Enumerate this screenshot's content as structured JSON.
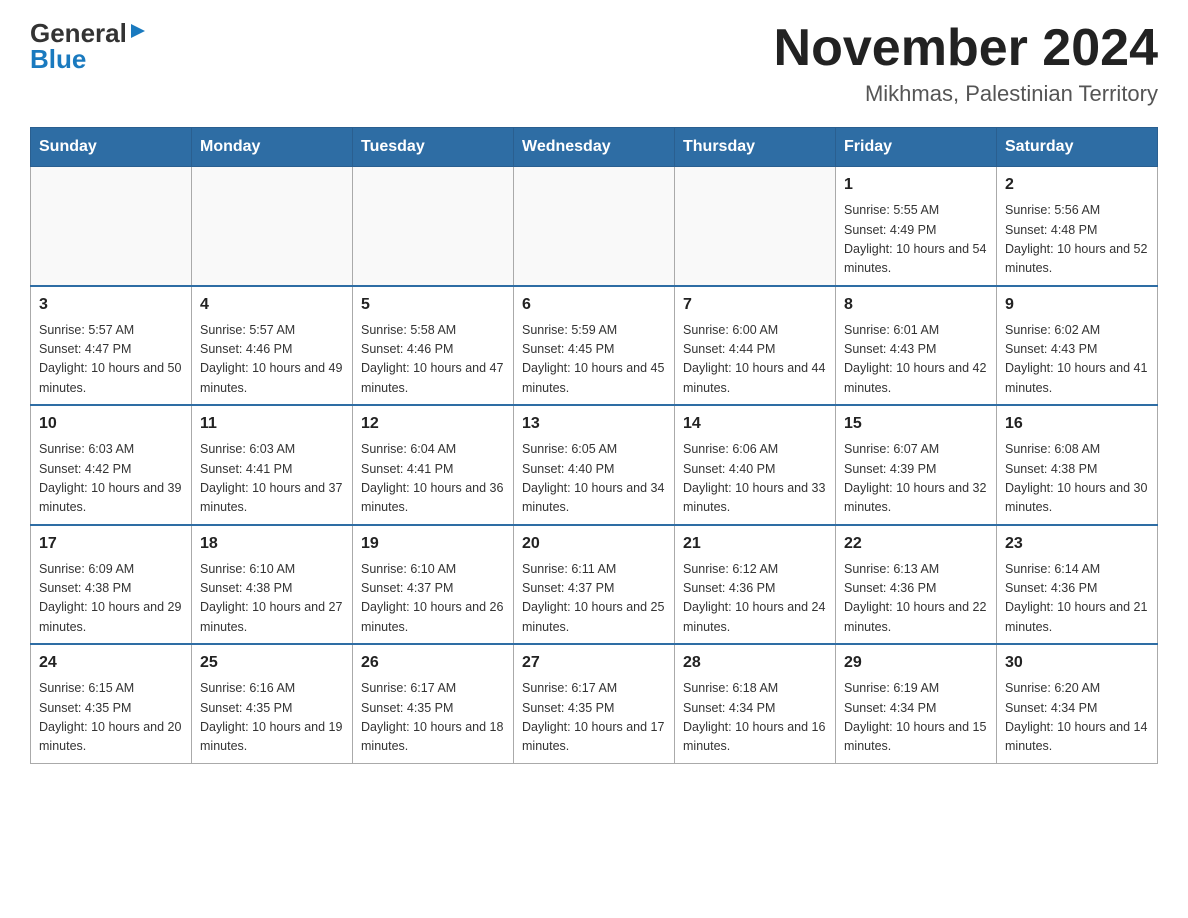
{
  "logo": {
    "general": "General",
    "blue": "Blue",
    "triangle": "▶"
  },
  "title": "November 2024",
  "subtitle": "Mikhmas, Palestinian Territory",
  "days_of_week": [
    "Sunday",
    "Monday",
    "Tuesday",
    "Wednesday",
    "Thursday",
    "Friday",
    "Saturday"
  ],
  "weeks": [
    [
      {
        "day": "",
        "info": ""
      },
      {
        "day": "",
        "info": ""
      },
      {
        "day": "",
        "info": ""
      },
      {
        "day": "",
        "info": ""
      },
      {
        "day": "",
        "info": ""
      },
      {
        "day": "1",
        "info": "Sunrise: 5:55 AM\nSunset: 4:49 PM\nDaylight: 10 hours and 54 minutes."
      },
      {
        "day": "2",
        "info": "Sunrise: 5:56 AM\nSunset: 4:48 PM\nDaylight: 10 hours and 52 minutes."
      }
    ],
    [
      {
        "day": "3",
        "info": "Sunrise: 5:57 AM\nSunset: 4:47 PM\nDaylight: 10 hours and 50 minutes."
      },
      {
        "day": "4",
        "info": "Sunrise: 5:57 AM\nSunset: 4:46 PM\nDaylight: 10 hours and 49 minutes."
      },
      {
        "day": "5",
        "info": "Sunrise: 5:58 AM\nSunset: 4:46 PM\nDaylight: 10 hours and 47 minutes."
      },
      {
        "day": "6",
        "info": "Sunrise: 5:59 AM\nSunset: 4:45 PM\nDaylight: 10 hours and 45 minutes."
      },
      {
        "day": "7",
        "info": "Sunrise: 6:00 AM\nSunset: 4:44 PM\nDaylight: 10 hours and 44 minutes."
      },
      {
        "day": "8",
        "info": "Sunrise: 6:01 AM\nSunset: 4:43 PM\nDaylight: 10 hours and 42 minutes."
      },
      {
        "day": "9",
        "info": "Sunrise: 6:02 AM\nSunset: 4:43 PM\nDaylight: 10 hours and 41 minutes."
      }
    ],
    [
      {
        "day": "10",
        "info": "Sunrise: 6:03 AM\nSunset: 4:42 PM\nDaylight: 10 hours and 39 minutes."
      },
      {
        "day": "11",
        "info": "Sunrise: 6:03 AM\nSunset: 4:41 PM\nDaylight: 10 hours and 37 minutes."
      },
      {
        "day": "12",
        "info": "Sunrise: 6:04 AM\nSunset: 4:41 PM\nDaylight: 10 hours and 36 minutes."
      },
      {
        "day": "13",
        "info": "Sunrise: 6:05 AM\nSunset: 4:40 PM\nDaylight: 10 hours and 34 minutes."
      },
      {
        "day": "14",
        "info": "Sunrise: 6:06 AM\nSunset: 4:40 PM\nDaylight: 10 hours and 33 minutes."
      },
      {
        "day": "15",
        "info": "Sunrise: 6:07 AM\nSunset: 4:39 PM\nDaylight: 10 hours and 32 minutes."
      },
      {
        "day": "16",
        "info": "Sunrise: 6:08 AM\nSunset: 4:38 PM\nDaylight: 10 hours and 30 minutes."
      }
    ],
    [
      {
        "day": "17",
        "info": "Sunrise: 6:09 AM\nSunset: 4:38 PM\nDaylight: 10 hours and 29 minutes."
      },
      {
        "day": "18",
        "info": "Sunrise: 6:10 AM\nSunset: 4:38 PM\nDaylight: 10 hours and 27 minutes."
      },
      {
        "day": "19",
        "info": "Sunrise: 6:10 AM\nSunset: 4:37 PM\nDaylight: 10 hours and 26 minutes."
      },
      {
        "day": "20",
        "info": "Sunrise: 6:11 AM\nSunset: 4:37 PM\nDaylight: 10 hours and 25 minutes."
      },
      {
        "day": "21",
        "info": "Sunrise: 6:12 AM\nSunset: 4:36 PM\nDaylight: 10 hours and 24 minutes."
      },
      {
        "day": "22",
        "info": "Sunrise: 6:13 AM\nSunset: 4:36 PM\nDaylight: 10 hours and 22 minutes."
      },
      {
        "day": "23",
        "info": "Sunrise: 6:14 AM\nSunset: 4:36 PM\nDaylight: 10 hours and 21 minutes."
      }
    ],
    [
      {
        "day": "24",
        "info": "Sunrise: 6:15 AM\nSunset: 4:35 PM\nDaylight: 10 hours and 20 minutes."
      },
      {
        "day": "25",
        "info": "Sunrise: 6:16 AM\nSunset: 4:35 PM\nDaylight: 10 hours and 19 minutes."
      },
      {
        "day": "26",
        "info": "Sunrise: 6:17 AM\nSunset: 4:35 PM\nDaylight: 10 hours and 18 minutes."
      },
      {
        "day": "27",
        "info": "Sunrise: 6:17 AM\nSunset: 4:35 PM\nDaylight: 10 hours and 17 minutes."
      },
      {
        "day": "28",
        "info": "Sunrise: 6:18 AM\nSunset: 4:34 PM\nDaylight: 10 hours and 16 minutes."
      },
      {
        "day": "29",
        "info": "Sunrise: 6:19 AM\nSunset: 4:34 PM\nDaylight: 10 hours and 15 minutes."
      },
      {
        "day": "30",
        "info": "Sunrise: 6:20 AM\nSunset: 4:34 PM\nDaylight: 10 hours and 14 minutes."
      }
    ]
  ]
}
